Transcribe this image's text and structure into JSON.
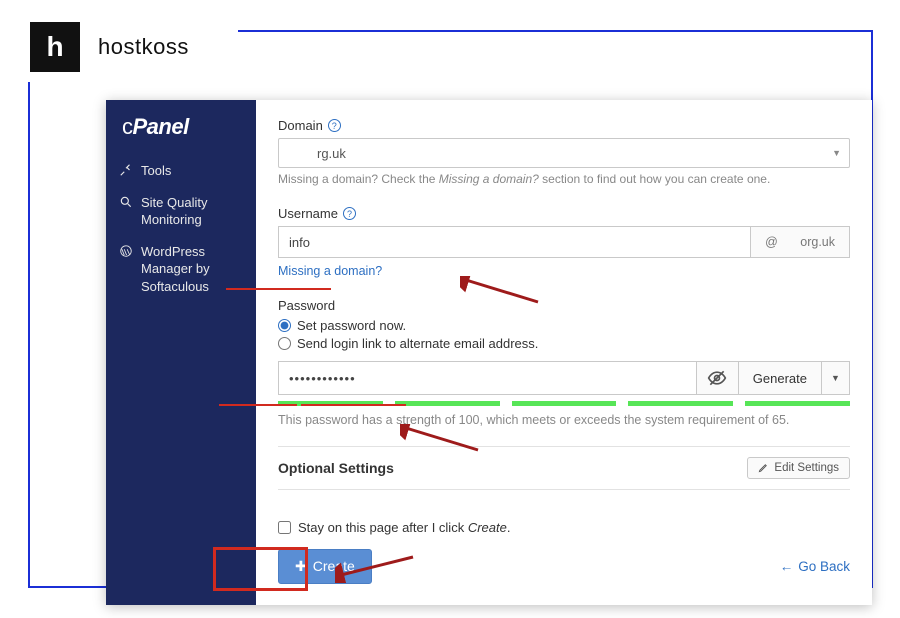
{
  "brand": {
    "logo_char": "h",
    "name": "hostkoss"
  },
  "cpanel": {
    "logo": "cPanel"
  },
  "sidebar": {
    "items": [
      {
        "icon": "tools",
        "label": "Tools"
      },
      {
        "icon": "search",
        "label": "Site Quality Monitoring"
      },
      {
        "icon": "wp",
        "label": "WordPress Manager by Softaculous"
      }
    ]
  },
  "form": {
    "domain_label": "Domain",
    "domain_value": "rg.uk",
    "domain_hint_a": "Missing a domain? Check the ",
    "domain_hint_b": "Missing a domain?",
    "domain_hint_c": " section to find out how you can create one.",
    "username_label": "Username",
    "username_value": "info",
    "username_suffix_at": "@",
    "username_suffix_domain": "org.uk",
    "missing_domain_link": "Missing a domain?",
    "password_label": "Password",
    "pw_set_now": "Set password now.",
    "pw_send_link": "Send login link to alternate email address.",
    "pw_value": "••••••••••••",
    "pw_generate": "Generate",
    "pw_strength_text": "This password has a strength of 100, which meets or exceeds the system requirement of 65.",
    "optional_heading": "Optional Settings",
    "edit_settings": "Edit Settings",
    "stay_label_a": "Stay on this page after I click ",
    "stay_label_b": "Create",
    "stay_label_c": ".",
    "create": "Create",
    "go_back": "Go Back"
  }
}
